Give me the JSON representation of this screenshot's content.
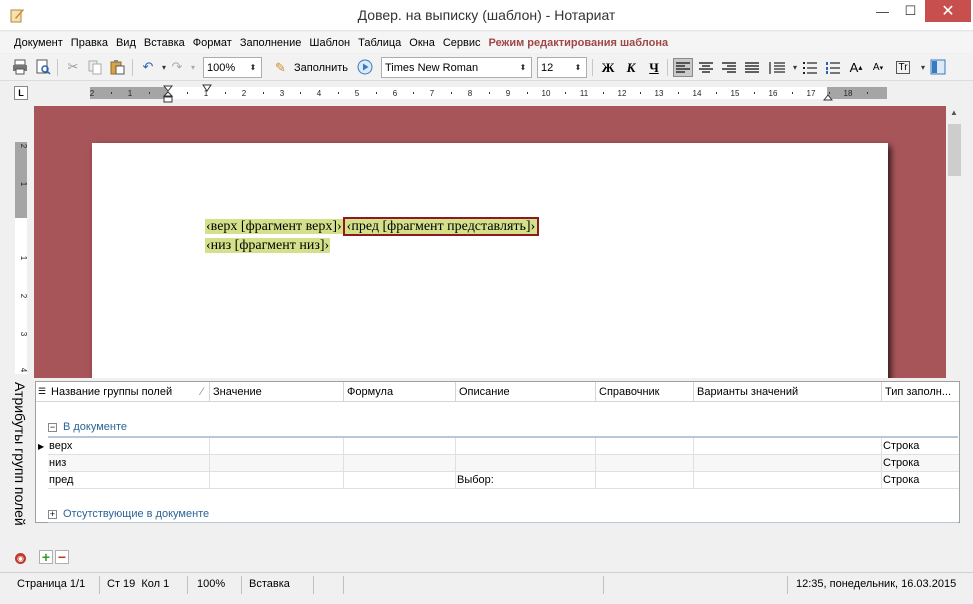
{
  "window": {
    "title": "Довер. на выписку (шаблон) - Нотариат",
    "minimize_glyph": "—",
    "maximize_glyph": "☐",
    "close_glyph": "✕"
  },
  "menu": {
    "items": [
      "Документ",
      "Правка",
      "Вид",
      "Вставка",
      "Формат",
      "Заполнение",
      "Шаблон",
      "Таблица",
      "Окна",
      "Сервис"
    ],
    "mode_label": "Режим редактирования шаблона"
  },
  "toolbar": {
    "zoom": "100%",
    "fill_label": "Заполнить",
    "font_name": "Times New Roman",
    "font_size": "12",
    "bold": "Ж",
    "italic": "К",
    "underline": "Ч"
  },
  "ruler": {
    "corner": "L",
    "h_ticks": [
      "2",
      "1",
      "1",
      "2",
      "3",
      "4",
      "5",
      "6",
      "7",
      "8",
      "9",
      "10",
      "11",
      "12",
      "13",
      "14",
      "15",
      "16",
      "17",
      "18"
    ],
    "v_ticks": [
      "2",
      "1",
      "1",
      "2",
      "3",
      "4"
    ]
  },
  "document": {
    "line1": [
      {
        "text": "‹верх [фрагмент верх]›",
        "selected": false
      },
      {
        "text": "‹пред [фрагмент представлять]›",
        "selected": true
      }
    ],
    "line2": [
      {
        "text": "‹низ [фрагмент низ]›",
        "selected": false
      }
    ]
  },
  "side_panel": {
    "label": "Атрибуты групп полей"
  },
  "grid": {
    "columns": [
      "Название группы полей",
      "Значение",
      "Формула",
      "Описание",
      "Справочник",
      "Варианты значений",
      "Тип заполн..."
    ],
    "group_in_doc": "В документе",
    "group_missing": "Отсутствующие в документе",
    "rows": [
      {
        "name": "верх",
        "value": "",
        "formula": "",
        "description": "",
        "reference": "",
        "variants": "",
        "type": "Строка"
      },
      {
        "name": "низ",
        "value": "",
        "formula": "",
        "description": "",
        "reference": "",
        "variants": "",
        "type": "Строка"
      },
      {
        "name": "пред",
        "value": "",
        "formula": "",
        "description": "Выбор:",
        "reference": "",
        "variants": "",
        "type": "Строка"
      }
    ]
  },
  "status": {
    "page": "Страница 1/1",
    "position": "Ст 19  Кол 1",
    "zoom": "100%",
    "mode": "Вставка",
    "datetime": "12:35, понедельник, 16.03.2015"
  }
}
